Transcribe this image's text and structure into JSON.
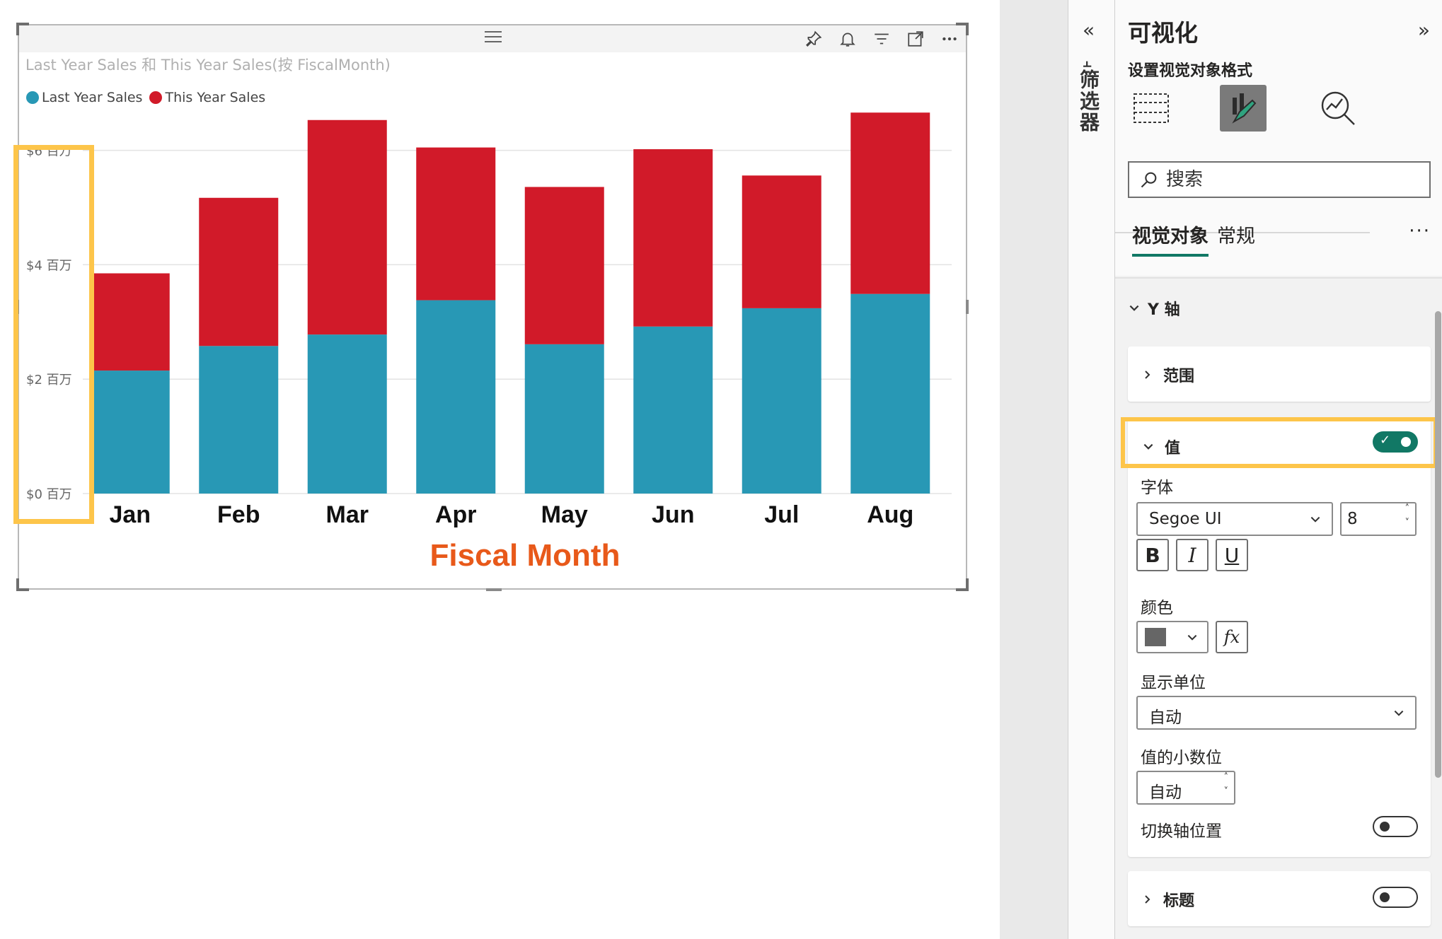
{
  "visual": {
    "title": "Last Year Sales 和 This Year Sales(按 FiscalMonth)",
    "header_icons": [
      "pin-icon",
      "bell-icon",
      "filter-icon",
      "focus-mode-icon",
      "more-options-icon"
    ]
  },
  "chart_data": {
    "type": "bar",
    "stacked": true,
    "categories": [
      "Jan",
      "Feb",
      "Mar",
      "Apr",
      "May",
      "Jun",
      "Jul",
      "Aug"
    ],
    "series": [
      {
        "name": "Last Year Sales",
        "color": "#2898B5",
        "values": [
          2.15,
          2.58,
          2.78,
          3.38,
          2.61,
          2.92,
          3.24,
          3.49
        ]
      },
      {
        "name": "This Year Sales",
        "color": "#D11A29",
        "values": [
          1.7,
          2.59,
          3.75,
          2.67,
          2.75,
          3.1,
          2.32,
          3.17
        ]
      }
    ],
    "y_ticks": [
      {
        "value": 0,
        "label": "$0 百万"
      },
      {
        "value": 2,
        "label": "$2 百万"
      },
      {
        "value": 4,
        "label": "$4 百万"
      },
      {
        "value": 6,
        "label": "$6 百万"
      }
    ],
    "ylim": [
      0,
      6.7
    ],
    "xlabel": "Fiscal Month",
    "xlabel_color": "#E8591A",
    "grid": true,
    "legend_position": "top-left"
  },
  "filters_pane": {
    "label": "筛选器"
  },
  "viz_pane": {
    "title": "可视化",
    "subtitle": "设置视觉对象格式",
    "search_placeholder": "搜索",
    "tabs": {
      "visual": "视觉对象",
      "general": "常规",
      "more": "···"
    },
    "section": "Y 轴",
    "range_card": {
      "label": "范围"
    },
    "values_card": {
      "label": "值",
      "toggle_on": true,
      "font_label": "字体",
      "font_family": "Segoe UI",
      "font_size": "8",
      "bold": "B",
      "italic": "I",
      "underline": "U",
      "color_label": "颜色",
      "color_value": "#666666",
      "fx": "fx",
      "display_units_label": "显示单位",
      "display_units_value": "自动",
      "decimals_label": "值的小数位",
      "decimals_value": "自动",
      "switch_axis_label": "切换轴位置",
      "switch_axis_on": false
    },
    "title_card": {
      "label": "标题",
      "toggle_on": false
    }
  }
}
